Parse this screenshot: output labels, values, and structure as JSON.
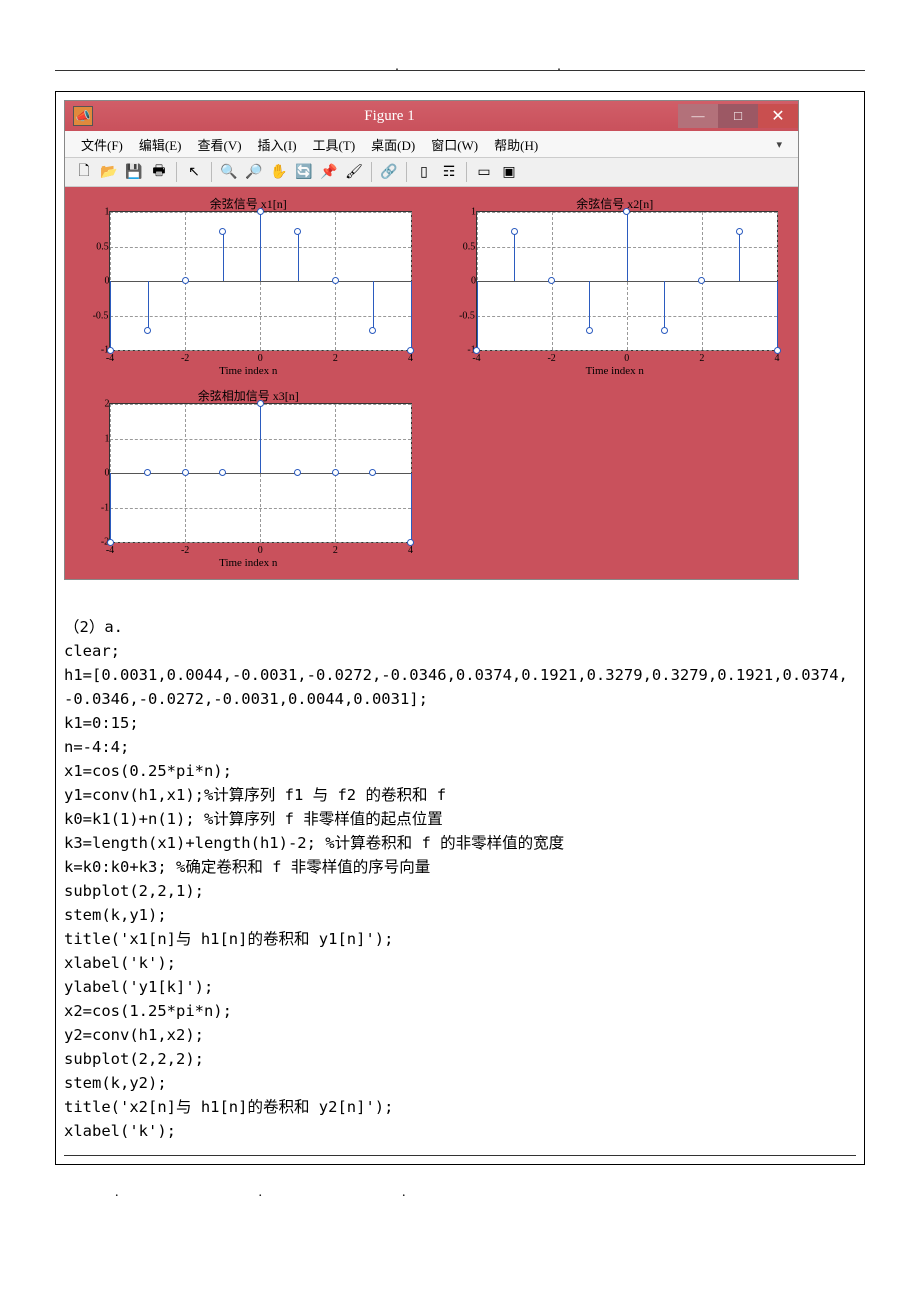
{
  "figure": {
    "app_icon": "📣",
    "title": "Figure 1",
    "win_buttons": {
      "min": "—",
      "max": "□",
      "close": "✕"
    },
    "menu": [
      "文件(F)",
      "编辑(E)",
      "查看(V)",
      "插入(I)",
      "工具(T)",
      "桌面(D)",
      "窗口(W)",
      "帮助(H)"
    ],
    "toolbar": {
      "new": "🗋",
      "open": "📂",
      "save": "💾",
      "print": "🖶",
      "arrow": "↖",
      "zoomin": "🔍",
      "zoomout": "🔎",
      "pan": "✋",
      "rotate": "🔄",
      "datatip": "📌",
      "brush": "🖌",
      "link": "🔗",
      "colorbar": "▯",
      "legend": "☶",
      "subplot1": "▭",
      "subplot2": "▣"
    }
  },
  "chart_data": [
    {
      "type": "stem",
      "title": "余弦信号 x1[n]",
      "xlabel": "Time index n",
      "x": [
        -4,
        -3,
        -2,
        -1,
        0,
        1,
        2,
        3,
        4
      ],
      "y": [
        -1,
        -0.707,
        0,
        0.707,
        1,
        0.707,
        0,
        -0.707,
        -1
      ],
      "xlim": [
        -4,
        4
      ],
      "ylim": [
        -1,
        1
      ],
      "yticks": [
        -1,
        -0.5,
        0,
        0.5,
        1
      ],
      "xticks": [
        -4,
        -2,
        0,
        2,
        4
      ]
    },
    {
      "type": "stem",
      "title": "余弦信号 x2[n]",
      "xlabel": "Time index n",
      "x": [
        -4,
        -3,
        -2,
        -1,
        0,
        1,
        2,
        3,
        4
      ],
      "y": [
        -1,
        0.707,
        0,
        -0.707,
        1,
        -0.707,
        0,
        0.707,
        -1
      ],
      "xlim": [
        -4,
        4
      ],
      "ylim": [
        -1,
        1
      ],
      "yticks": [
        -1,
        -0.5,
        0,
        0.5,
        1
      ],
      "xticks": [
        -4,
        -2,
        0,
        2,
        4
      ]
    },
    {
      "type": "stem",
      "title": "余弦相加信号 x3[n]",
      "xlabel": "Time index n",
      "x": [
        -4,
        -3,
        -2,
        -1,
        0,
        1,
        2,
        3,
        4
      ],
      "y": [
        -2,
        0,
        0,
        0,
        2,
        0,
        0,
        0,
        -2
      ],
      "xlim": [
        -4,
        4
      ],
      "ylim": [
        -2,
        2
      ],
      "yticks": [
        -2,
        -1,
        0,
        1,
        2
      ],
      "xticks": [
        -4,
        -2,
        0,
        2,
        4
      ]
    }
  ],
  "code": {
    "l1": "（2）a.",
    "l2": "clear;",
    "l3": "h1=[0.0031,0.0044,-0.0031,-0.0272,-0.0346,0.0374,0.1921,0.3279,0.3279,0.1921,0.0374,-0.0346,-0.0272,-0.0031,0.0044,0.0031];",
    "l4": "k1=0:15;",
    "l5": "n=-4:4;",
    "l6": "x1=cos(0.25*pi*n);",
    "l7": "y1=conv(h1,x1);%计算序列 f1 与 f2 的卷积和 f",
    "l8": "k0=k1(1)+n(1); %计算序列 f 非零样值的起点位置",
    "l9": "k3=length(x1)+length(h1)-2; %计算卷积和 f 的非零样值的宽度",
    "l10": "k=k0:k0+k3; %确定卷积和 f 非零样值的序号向量",
    "l11": "subplot(2,2,1);",
    "l12": "stem(k,y1);",
    "l13": "title('x1[n]与 h1[n]的卷积和 y1[n]');",
    "l14": "xlabel('k');",
    "l15": "ylabel('y1[k]');",
    "l16": "x2=cos(1.25*pi*n);",
    "l17": "y2=conv(h1,x2);",
    "l18": "subplot(2,2,2);",
    "l19": "stem(k,y2);",
    "l20": "title('x2[n]与 h1[n]的卷积和 y2[n]');",
    "l21": "xlabel('k');"
  }
}
